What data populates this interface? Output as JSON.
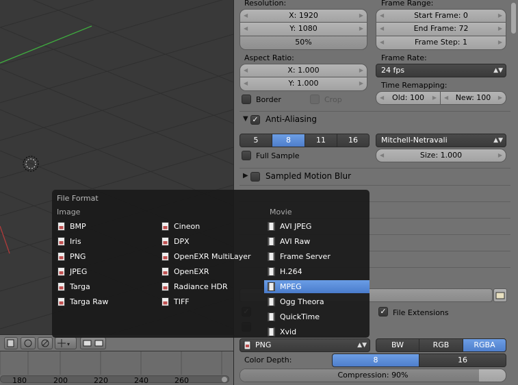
{
  "props": {
    "resolution_label": "Resolution:",
    "res_x": "X: 1920",
    "res_y": "Y: 1080",
    "res_pct": "50%",
    "frame_range_label": "Frame Range:",
    "start_frame": "Start Frame: 0",
    "end_frame": "End Frame: 72",
    "frame_step": "Frame Step: 1",
    "aspect_label": "Aspect Ratio:",
    "aspect_x": "X: 1.000",
    "aspect_y": "Y: 1.000",
    "frame_rate_label": "Frame Rate:",
    "frame_rate": "24 fps",
    "border_label": "Border",
    "crop_label": "Crop",
    "time_remap_label": "Time Remapping:",
    "old": "Old: 100",
    "new": "New: 100",
    "aa_title": "Anti-Aliasing",
    "aa_samples": [
      "5",
      "8",
      "11",
      "16"
    ],
    "aa_active": "8",
    "aa_filter": "Mitchell-Netravali",
    "full_sample_label": "Full Sample",
    "aa_size": "Size: 1.000",
    "smb_title": "Sampled Motion Blur",
    "file_extensions_label": "File Extensions",
    "format_value": "PNG",
    "color_modes": [
      "BW",
      "RGB",
      "RGBA"
    ],
    "color_mode_active": "RGBA",
    "color_depth_label": "Color Depth:",
    "color_depths": [
      "8",
      "16"
    ],
    "color_depth_active": "8",
    "compression": "Compression: 90%",
    "compression_value": 90
  },
  "popup": {
    "title": "File Format",
    "image_header": "Image",
    "movie_header": "Movie",
    "image_col1": [
      "BMP",
      "Iris",
      "PNG",
      "JPEG",
      "Targa",
      "Targa Raw"
    ],
    "image_col2": [
      "Cineon",
      "DPX",
      "OpenEXR MultiLayer",
      "OpenEXR",
      "Radiance HDR",
      "TIFF"
    ],
    "movie": [
      "AVI JPEG",
      "AVI Raw",
      "Frame Server",
      "H.264",
      "MPEG",
      "Ogg Theora",
      "QuickTime",
      "Xvid"
    ],
    "highlighted": "MPEG"
  },
  "timeline": {
    "ticks": [
      "180",
      "200",
      "220",
      "240",
      "260"
    ]
  }
}
